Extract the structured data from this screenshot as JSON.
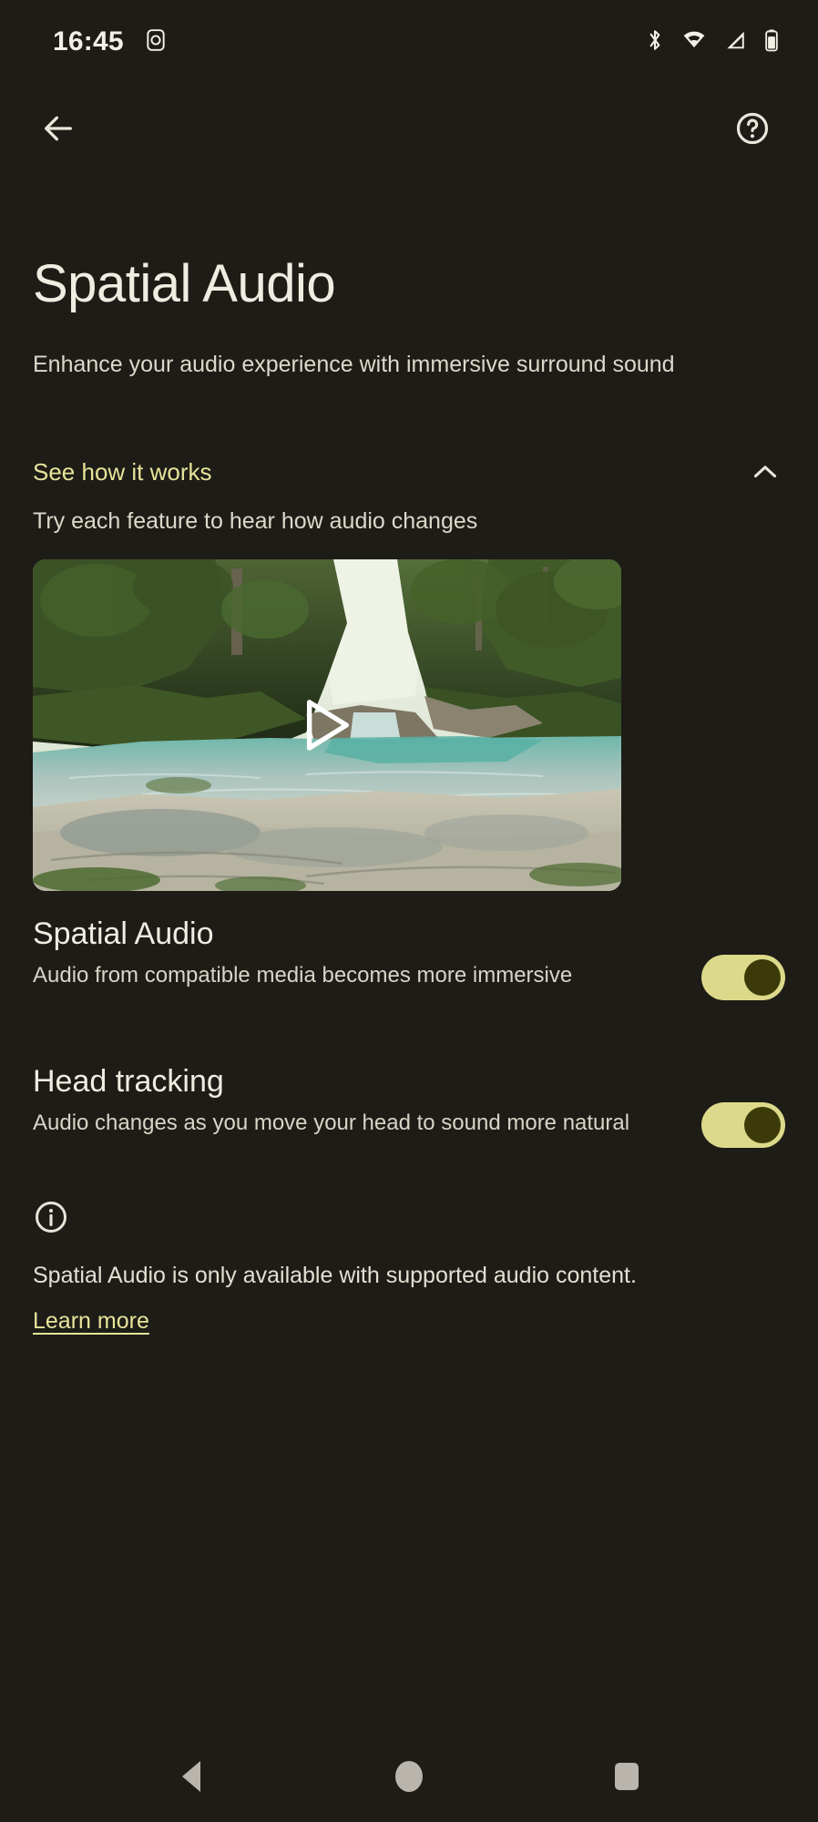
{
  "status_bar": {
    "time": "16:45",
    "left_icons": [
      "screenshot-icon"
    ],
    "right_icons": [
      "bluetooth-icon",
      "wifi-icon",
      "cellular-signal-icon",
      "battery-icon"
    ]
  },
  "app_bar": {
    "back_label": "Back",
    "help_label": "Help"
  },
  "page": {
    "title": "Spatial Audio",
    "subtitle": "Enhance your audio experience with immersive surround sound"
  },
  "demo_section": {
    "link_label": "See how it works",
    "expanded": true,
    "chevron": "chevron-up-icon",
    "description": "Try each feature to hear how audio changes",
    "video": {
      "alt": "Forest gorge with turquoise stream over rocks",
      "play_label": "Play"
    }
  },
  "settings": [
    {
      "title": "Spatial Audio",
      "description": "Audio from compatible media becomes more immersive",
      "enabled": true
    },
    {
      "title": "Head tracking",
      "description": "Audio changes as you move your head to sound more natural",
      "enabled": true
    }
  ],
  "footer": {
    "icon": "info-icon",
    "note": "Spatial Audio is only available with supported audio content.",
    "link_label": "Learn more"
  },
  "nav_bar": {
    "back_label": "Back",
    "home_label": "Home",
    "recents_label": "Recent apps"
  },
  "colors": {
    "background": "#1e1c17",
    "accent": "#e7e49a",
    "switch_track_on": "#dcd98a",
    "switch_thumb_on": "#3c3a08",
    "primary_text": "#f0ece1",
    "secondary_text": "#d9d4c7"
  }
}
